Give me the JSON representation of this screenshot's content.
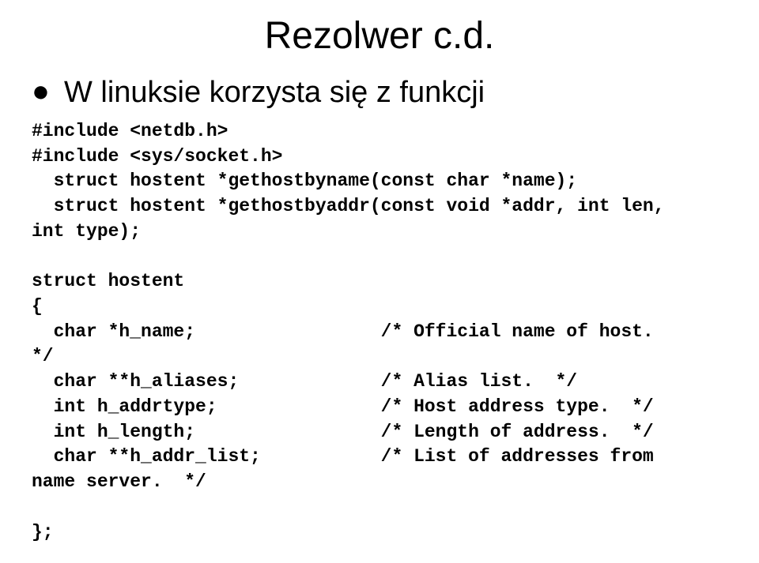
{
  "title": "Rezolwer c.d.",
  "bullet": "W linuksie korzysta się z funkcji",
  "code": "#include <netdb.h>\n#include <sys/socket.h>\n  struct hostent *gethostbyname(const char *name);\n  struct hostent *gethostbyaddr(const void *addr, int len,\nint type);\n\nstruct hostent\n{\n  char *h_name;                 /* Official name of host. \n*/\n  char **h_aliases;             /* Alias list.  */\n  int h_addrtype;               /* Host address type.  */\n  int h_length;                 /* Length of address.  */\n  char **h_addr_list;           /* List of addresses from \nname server.  */\n\n};"
}
